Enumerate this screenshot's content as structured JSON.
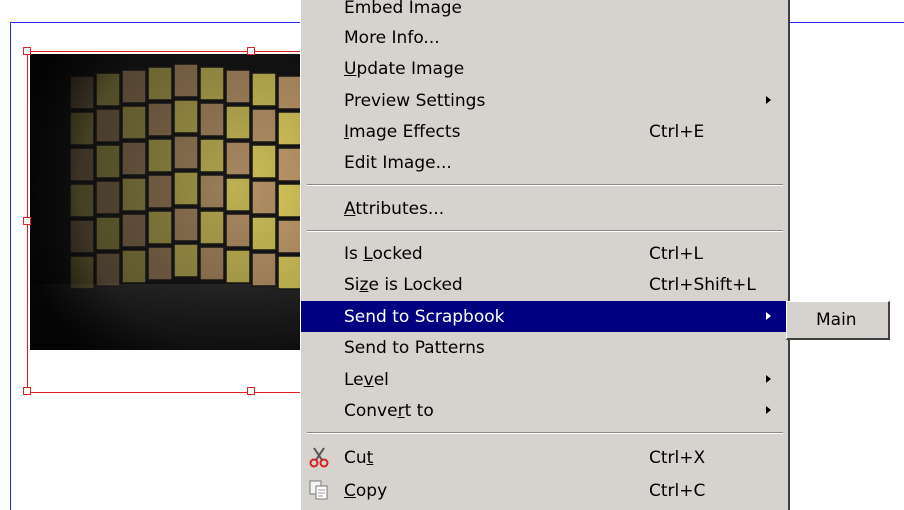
{
  "menu": {
    "items": [
      {
        "label": "Embed Image",
        "shortcut": "",
        "submenu": false
      },
      {
        "label": "More Info...",
        "shortcut": "",
        "submenu": false
      },
      {
        "label": "Update Image",
        "shortcut": "",
        "submenu": false,
        "mnemonic": "U"
      },
      {
        "label": "Preview Settings",
        "shortcut": "",
        "submenu": true
      },
      {
        "label": "Image Effects",
        "shortcut": "Ctrl+E",
        "submenu": false,
        "mnemonic": "I"
      },
      {
        "label": "Edit Image...",
        "shortcut": "",
        "submenu": false
      },
      {
        "label": "Attributes...",
        "shortcut": "",
        "submenu": false,
        "mnemonic": "A"
      },
      {
        "label": "Is Locked",
        "shortcut": "Ctrl+L",
        "submenu": false,
        "mnemonic": "L"
      },
      {
        "label": "Size is Locked",
        "shortcut": "Ctrl+Shift+L",
        "submenu": false,
        "mnemonic": "z"
      },
      {
        "label": "Send to Scrapbook",
        "shortcut": "",
        "submenu": true,
        "active": true
      },
      {
        "label": "Send to Patterns",
        "shortcut": "",
        "submenu": false
      },
      {
        "label": "Level",
        "shortcut": "",
        "submenu": true,
        "mnemonic": "v"
      },
      {
        "label": "Convert to",
        "shortcut": "",
        "submenu": true,
        "mnemonic": "r"
      },
      {
        "label": "Cut",
        "shortcut": "Ctrl+X",
        "submenu": false,
        "icon": "scissors-icon",
        "mnemonic": "t"
      },
      {
        "label": "Copy",
        "shortcut": "Ctrl+C",
        "submenu": false,
        "icon": "copy-icon",
        "mnemonic": "C"
      }
    ]
  },
  "submenu": {
    "items": [
      {
        "label": "Main"
      }
    ]
  },
  "colors": {
    "menu_bg": "#d6d3ce",
    "highlight": "#000080",
    "frame": "#e02020",
    "page_border": "#2a2ae6"
  }
}
